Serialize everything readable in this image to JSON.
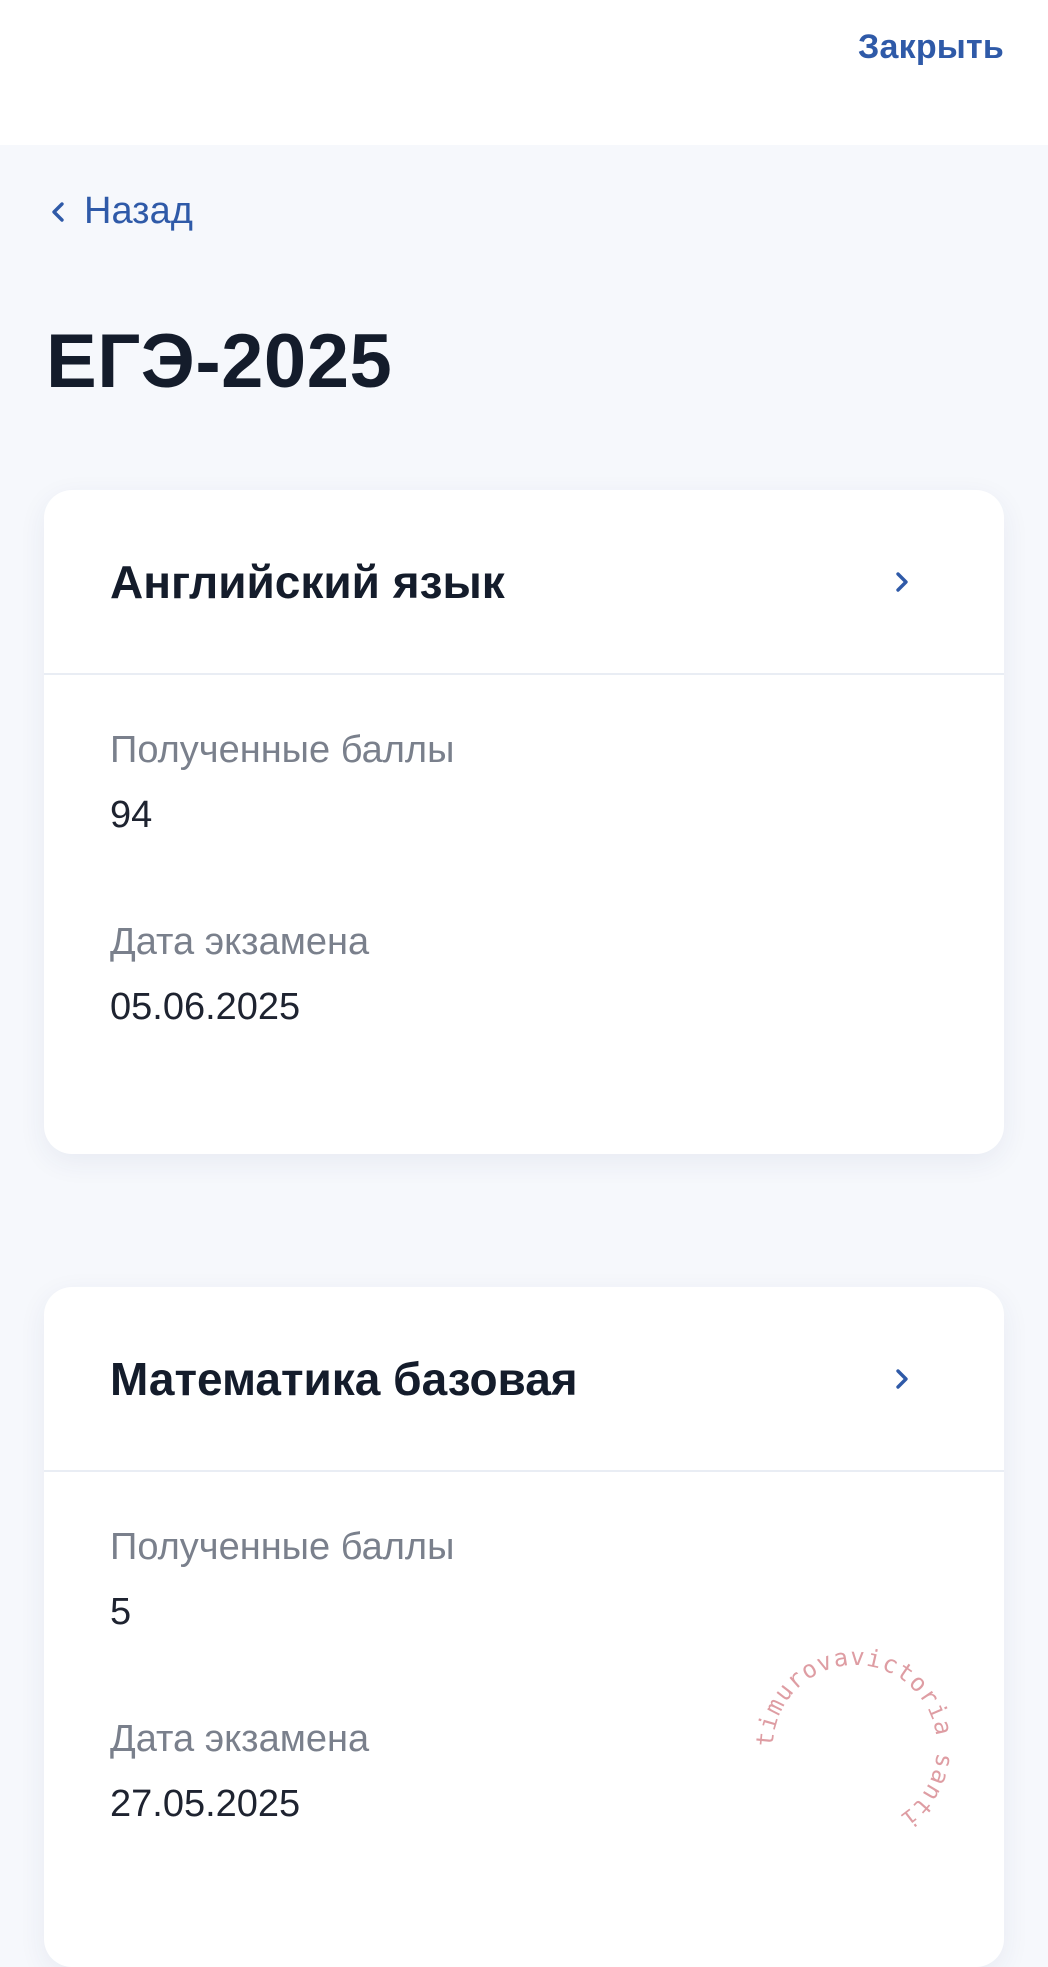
{
  "header": {
    "close_label": "Закрыть"
  },
  "nav": {
    "back_label": "Назад"
  },
  "page": {
    "title": "ЕГЭ-2025"
  },
  "exams": [
    {
      "subject": "Английский язык",
      "score_label": "Полученные баллы",
      "score": "94",
      "date_label": "Дата экзамена",
      "date": "05.06.2025"
    },
    {
      "subject": "Математика базовая",
      "score_label": "Полученные баллы",
      "score": "5",
      "date_label": "Дата экзамена",
      "date": "27.05.2025"
    }
  ],
  "watermark": {
    "text": "timurovavictoria santi"
  },
  "colors": {
    "accent": "#2f5aa8",
    "text_primary": "#141c2b",
    "text_secondary": "#7a808c",
    "background": "#f6f8fc",
    "card": "#ffffff"
  }
}
